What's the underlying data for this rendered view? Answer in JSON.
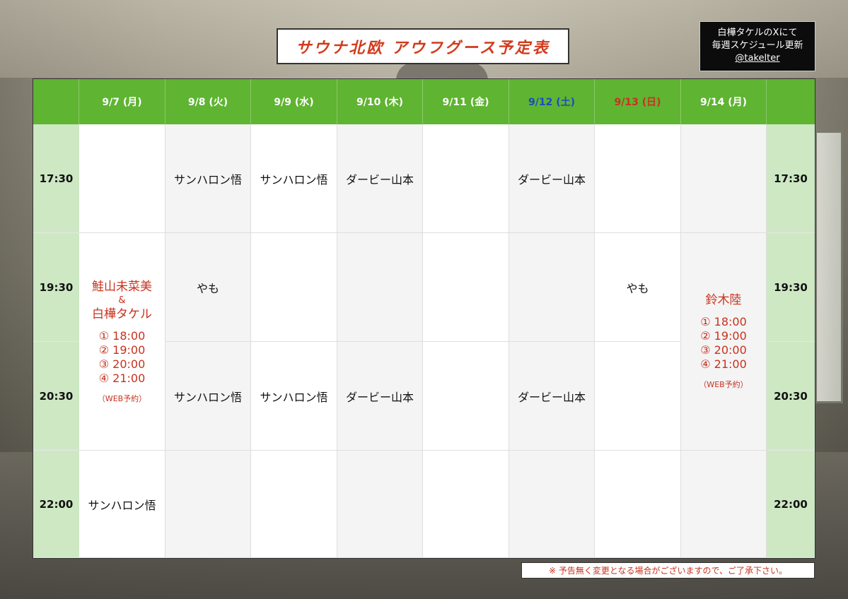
{
  "title": "サウナ北欧 アウフグース予定表",
  "info": {
    "line1": "白樺タケルのXにて",
    "line2": "毎週スケジュール更新",
    "handle": "@takelter"
  },
  "days": [
    "9/7 (月)",
    "9/8 (火)",
    "9/9 (水)",
    "9/10 (木)",
    "9/11 (金)",
    "9/12 (土)",
    "9/13 (日)",
    "9/14 (月)"
  ],
  "times": [
    "17:30",
    "19:30",
    "20:30",
    "22:00"
  ],
  "slots": {
    "r1": [
      "",
      "サンハロン悟",
      "サンハロン悟",
      "ダービー山本",
      "",
      "ダービー山本",
      "",
      ""
    ],
    "r2": [
      "",
      "やも",
      "",
      "",
      "",
      "",
      "やも",
      ""
    ],
    "r3": [
      "",
      "サンハロン悟",
      "サンハロン悟",
      "ダービー山本",
      "",
      "ダービー山本",
      "",
      ""
    ],
    "r4": [
      "サンハロン悟",
      "",
      "",
      "",
      "",
      "",
      "",
      ""
    ]
  },
  "special_mon1": {
    "name1": "鮭山未菜美",
    "amp": "&",
    "name2": "白樺タケル",
    "t1": "① 18:00",
    "t2": "② 19:00",
    "t3": "③ 20:00",
    "t4": "④ 21:00",
    "note": "（WEB予約）"
  },
  "special_mon2": {
    "name": "鈴木陸",
    "t1": "① 18:00",
    "t2": "② 19:00",
    "t3": "③ 20:00",
    "t4": "④ 21:00",
    "note": "（WEB予約）"
  },
  "notice": "※ 予告無く変更となる場合がございますので、ご了承下さい。",
  "colors": {
    "header_green": "#5fb432",
    "time_green": "#cde8c3",
    "saturday": "#1a4bc4",
    "sunday": "#c8321e",
    "accent_red": "#c8321e"
  }
}
